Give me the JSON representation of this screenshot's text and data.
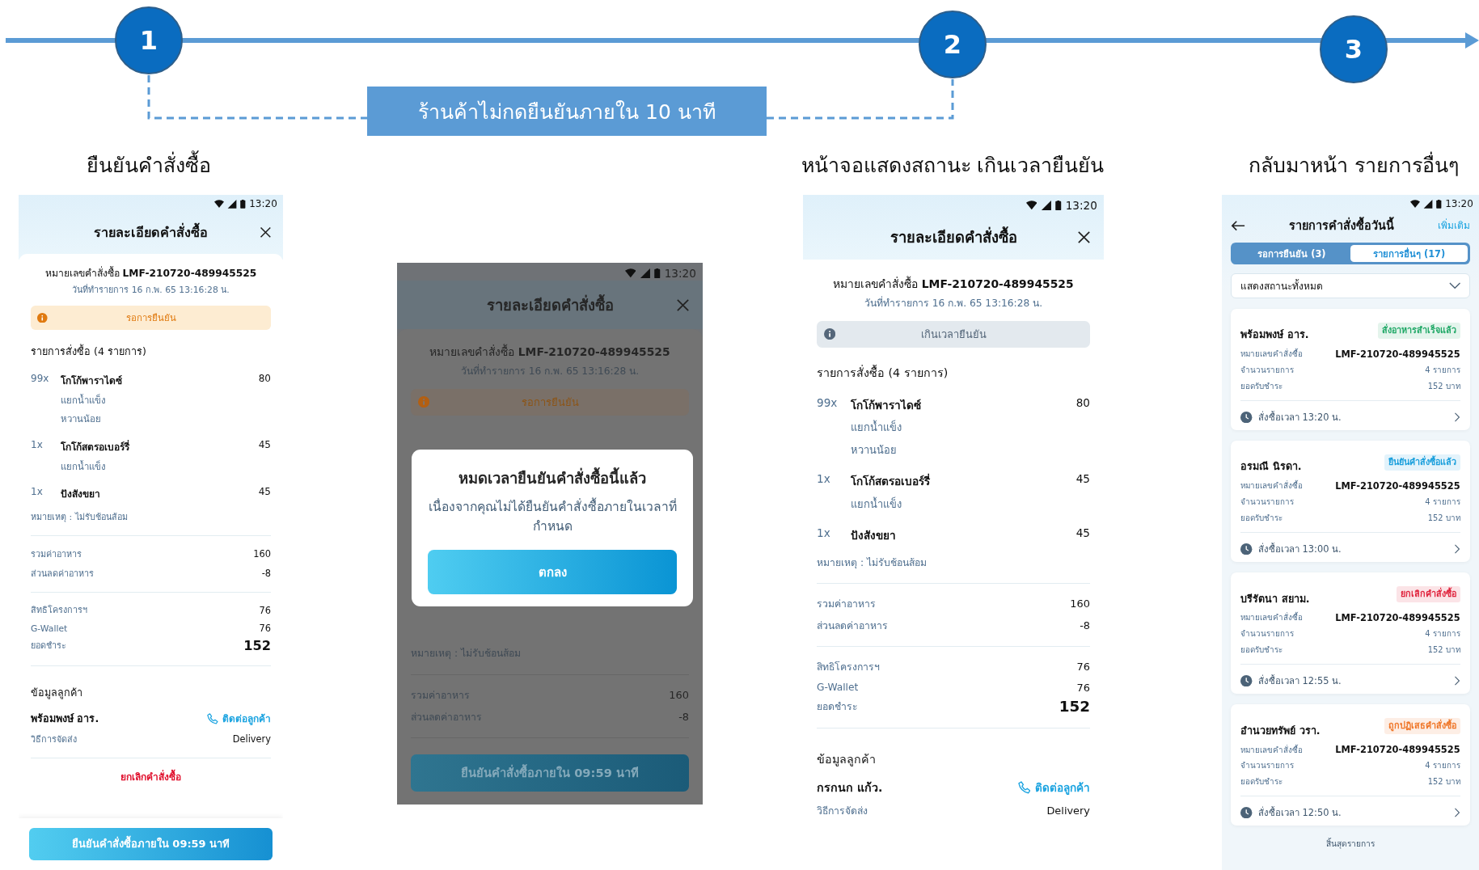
{
  "flow": {
    "steps": [
      {
        "number": "1",
        "caption": "ยืนยันคำสั่งซื้อ"
      },
      {
        "number": "2",
        "caption": "หน้าจอแสดงสถานะ เกินเวลายืนยัน"
      },
      {
        "number": "3",
        "caption": "กลับมาหน้า รายการอื่นๆ"
      }
    ],
    "connector_label": "ร้านค้าไม่กดยืนยันภายใน 10 นาที"
  },
  "screens": [
    {
      "kind": "order_detail",
      "status_bar": {
        "time": "13:20"
      },
      "title": "รายละเอียดคำสั่งซื้อ",
      "order_number_label": "หมายเลขคำสั่งซื้อ",
      "order_number": "LMF-210720-489945525",
      "order_date": "วันที่ทำรายการ 16 ก.พ. 65 13:16:28 น.",
      "status": {
        "kind": "pending",
        "label": "รอการยืนยัน"
      },
      "items_heading": "รายการสั่งซื้อ (4 รายการ)",
      "items": [
        {
          "qty": "99x",
          "name": "โกโก้พาราไดซ์",
          "price": "80",
          "options": [
            "แยกน้ำแข็ง",
            "หวานน้อย"
          ]
        },
        {
          "qty": "1x",
          "name": "โกโก้สตรอเบอร์รี่",
          "price": "45",
          "options": [
            "แยกน้ำแข็ง"
          ]
        },
        {
          "qty": "1x",
          "name": "ปังสังขยา",
          "price": "45"
        }
      ],
      "note": "หมายเหตุ : ไม่รับช้อนส้อม",
      "subtotals": [
        {
          "label": "รวมค่าอาหาร",
          "value": "160"
        },
        {
          "label": "ส่วนลดค่าอาหาร",
          "value": "-8"
        }
      ],
      "payments": [
        {
          "label": "สิทธิโครงการฯ",
          "value": "76"
        },
        {
          "label": "G-Wallet",
          "value": "76"
        }
      ],
      "total": {
        "label": "ยอดชำระ",
        "value": "152"
      },
      "customer": {
        "heading": "ข้อมูลลูกค้า",
        "name": "พร้อมพงษ์ อาร.",
        "contact": "ติดต่อลูกค้า",
        "delivery_label": "วิธีการจัดส่ง",
        "delivery_value": "Delivery"
      },
      "cancel_link": "ยกเลิกคำสั่งซื้อ",
      "confirm_button": "ยืนยันคำสั่งซื้อภายใน 09:59 นาที"
    },
    {
      "kind": "timeout_dialog",
      "status_bar": {
        "time": "13:20"
      },
      "title": "รายละเอียดคำสั่งซื้อ",
      "order_number_label": "หมายเลขคำสั่งซื้อ",
      "order_number": "LMF-210720-489945525",
      "order_date": "วันที่ทำรายการ 16 ก.พ. 65 13:16:28 น.",
      "status": {
        "kind": "pending",
        "label": "รอการยืนยัน"
      },
      "note": "หมายเหตุ : ไม่รับช้อนส้อม",
      "subtotals": [
        {
          "label": "รวมค่าอาหาร",
          "value": "160"
        },
        {
          "label": "ส่วนลดค่าอาหาร",
          "value": "-8"
        }
      ],
      "confirm_button": "ยืนยันคำสั่งซื้อภายใน 09:59 นาที",
      "dialog": {
        "title": "หมดเวลายืนยันคำสั่งซื้อนี้แล้ว",
        "message": "เนื่องจากคุณไม่ได้ยืนยันคำสั่งซื้อภายในเวลาที่กำหนด",
        "button": "ตกลง"
      }
    },
    {
      "kind": "order_detail",
      "status_bar": {
        "time": "13:20"
      },
      "title": "รายละเอียดคำสั่งซื้อ",
      "order_number_label": "หมายเลขคำสั่งซื้อ",
      "order_number": "LMF-210720-489945525",
      "order_date": "วันที่ทำรายการ 16 ก.พ. 65 13:16:28 น.",
      "status": {
        "kind": "expired",
        "label": "เกินเวลายืนยัน"
      },
      "items_heading": "รายการสั่งซื้อ (4 รายการ)",
      "items": [
        {
          "qty": "99x",
          "name": "โกโก้พาราไดซ์",
          "price": "80",
          "options": [
            "แยกน้ำแข็ง",
            "หวานน้อย"
          ]
        },
        {
          "qty": "1x",
          "name": "โกโก้สตรอเบอร์รี่",
          "price": "45",
          "options": [
            "แยกน้ำแข็ง"
          ]
        },
        {
          "qty": "1x",
          "name": "ปังสังขยา",
          "price": "45"
        }
      ],
      "note": "หมายเหตุ : ไม่รับช้อนส้อม",
      "subtotals": [
        {
          "label": "รวมค่าอาหาร",
          "value": "160"
        },
        {
          "label": "ส่วนลดค่าอาหาร",
          "value": "-8"
        }
      ],
      "payments": [
        {
          "label": "สิทธิโครงการฯ",
          "value": "76"
        },
        {
          "label": "G-Wallet",
          "value": "76"
        }
      ],
      "total": {
        "label": "ยอดชำระ",
        "value": "152"
      },
      "customer": {
        "heading": "ข้อมูลลูกค้า",
        "name": "กรกนก แก้ว.",
        "contact": "ติดต่อลูกค้า",
        "delivery_label": "วิธีการจัดส่ง",
        "delivery_value": "Delivery"
      }
    },
    {
      "kind": "order_list",
      "status_bar": {
        "time": "13:20"
      },
      "title": "รายการคำสั่งซื้อวันนี้",
      "action": "เพิ่มเติม",
      "tabs": [
        {
          "label": "รอการยืนยัน (3)",
          "selected": false
        },
        {
          "label": "รายการอื่นๆ (17)",
          "selected": true
        }
      ],
      "filter": {
        "value": "แสดงสถานะทั้งหมด"
      },
      "orders": [
        {
          "customer": "พร้อมพงษ์ อาร.",
          "status": "สั่งอาหารสำเร็จแล้ว",
          "color": "#1fa866",
          "order_label": "หมายเลขคำสั่งซื้อ",
          "order_number": "LMF-210720-489945525",
          "items_label": "จำนวนรายการ",
          "items_value": "4 รายการ",
          "total_label": "ยอดรับชำระ",
          "total_value": "152 บาท",
          "time": "สั่งซื้อเวลา 13:20 น."
        },
        {
          "customer": "อรมณี นิรดา.",
          "status": "ยืนยันคำสั่งซื้อแล้ว",
          "color": "#1a9fdc",
          "order_label": "หมายเลขคำสั่งซื้อ",
          "order_number": "LMF-210720-489945525",
          "items_label": "จำนวนรายการ",
          "items_value": "4 รายการ",
          "total_label": "ยอดรับชำระ",
          "total_value": "152 บาท",
          "time": "สั่งซื้อเวลา 13:00 น."
        },
        {
          "customer": "บรีรัตนา สยาม.",
          "status": "ยกเลิกคำสั่งซื้อ",
          "color": "#e0243d",
          "order_label": "หมายเลขคำสั่งซื้อ",
          "order_number": "LMF-210720-489945525",
          "items_label": "จำนวนรายการ",
          "items_value": "4 รายการ",
          "total_label": "ยอดรับชำระ",
          "total_value": "152 บาท",
          "time": "สั่งซื้อเวลา 12:55 น."
        },
        {
          "customer": "อำนวยทรัพย์ วรา.",
          "status": "ถูกปฏิเสธคำสั่งซื้อ",
          "color": "#ef7526",
          "order_label": "หมายเลขคำสั่งซื้อ",
          "order_number": "LMF-210720-489945525",
          "items_label": "จำนวนรายการ",
          "items_value": "4 รายการ",
          "total_label": "ยอดรับชำระ",
          "total_value": "152 บาท",
          "time": "สั่งซื้อเวลา 12:50 น."
        }
      ],
      "end_label": "สิ้นสุดรายการ"
    }
  ]
}
